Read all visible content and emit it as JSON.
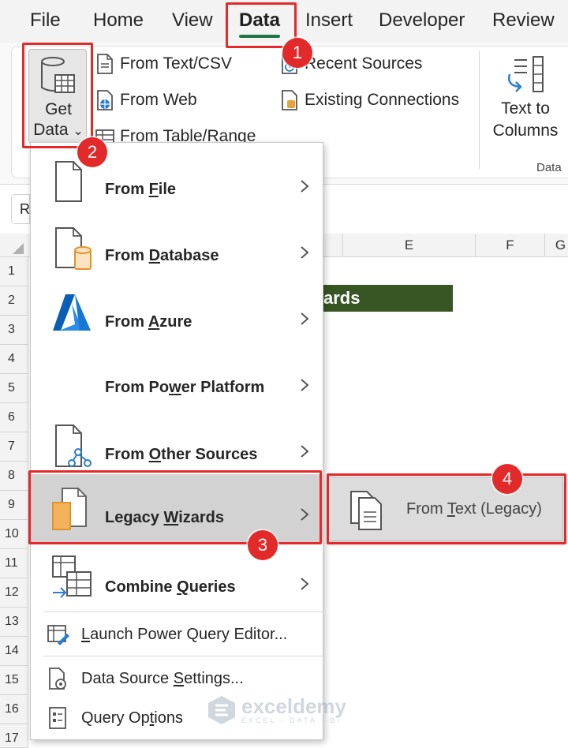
{
  "tabs": [
    {
      "label": "File"
    },
    {
      "label": "Home"
    },
    {
      "label": "View"
    },
    {
      "label": "Data"
    },
    {
      "label": "Insert"
    },
    {
      "label": "Developer"
    },
    {
      "label": "Review"
    }
  ],
  "active_tab": "Data",
  "ribbon": {
    "get_data": {
      "line1": "Get",
      "line2": "Data",
      "chevron": "⌄"
    },
    "from_text_csv": "From Text/CSV",
    "from_web": "From Web",
    "from_table_range": "From Table/Range",
    "recent_sources": "Recent Sources",
    "existing_connections": "Existing Connections",
    "text_to_columns": {
      "line1": "Text to",
      "line2": "Columns"
    },
    "group_label": "Data"
  },
  "namebox": {
    "value": "R"
  },
  "grid": {
    "columns": [
      "E",
      "F",
      "G"
    ],
    "rows": [
      "1",
      "2",
      "3",
      "4",
      "5",
      "6",
      "7",
      "8",
      "9",
      "10",
      "11",
      "12",
      "13",
      "14",
      "15",
      "16",
      "17"
    ],
    "cell_text": "ards"
  },
  "menu": {
    "items": [
      {
        "pre": "From ",
        "key": "F",
        "post": "ile",
        "icon": "file-icon"
      },
      {
        "pre": "From ",
        "key": "D",
        "post": "atabase",
        "icon": "database-icon"
      },
      {
        "pre": "From ",
        "key": "A",
        "post": "zure",
        "icon": "azure-icon"
      },
      {
        "pre": "From Po",
        "key": "w",
        "post": "er Platform",
        "icon": ""
      },
      {
        "pre": "From ",
        "key": "O",
        "post": "ther Sources",
        "icon": "other-sources-icon"
      },
      {
        "pre": "Legacy ",
        "key": "W",
        "post": "izards",
        "icon": "legacy-wizards-icon"
      },
      {
        "pre": "Combine ",
        "key": "Q",
        "post": "ueries",
        "icon": "combine-queries-icon"
      }
    ],
    "simple_items": [
      {
        "pre": "",
        "key": "L",
        "post": "aunch Power Query Editor...",
        "icon": "query-editor-icon"
      },
      {
        "pre": "Data Source ",
        "key": "S",
        "post": "ettings...",
        "icon": "data-source-settings-icon"
      },
      {
        "pre": "Query Op",
        "key": "t",
        "post": "ions",
        "icon": "query-options-icon"
      }
    ],
    "chevron": "›"
  },
  "submenu": {
    "pre": "From ",
    "key": "T",
    "post": "ext (Legacy)"
  },
  "badges": [
    "1",
    "2",
    "3",
    "4"
  ],
  "watermark": {
    "name": "exceldemy",
    "tag": "EXCEL · DATA · BI"
  },
  "colors": {
    "excel_green": "#217346",
    "annotation_red": "#e22a2a",
    "header_green": "#375623",
    "highlight": "#d2d2d2"
  }
}
